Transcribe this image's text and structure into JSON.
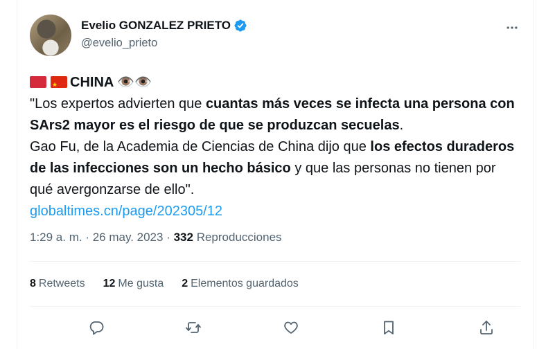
{
  "author": {
    "name": "Evelio GONZALEZ PRIETO",
    "handle": "@evelio_prieto",
    "verified_icon": "verified-badge-icon"
  },
  "tweet": {
    "line1": "CHINA ",
    "eyes": "👁️👁️",
    "p1_a": "\"Los expertos advierten que ",
    "p1_b": "cuantas más veces se infecta una persona con SArs2 mayor es el riesgo de que se produzcan secuelas",
    "p1_c": ".",
    "p2_a": "Gao Fu, de la Academia de Ciencias de China dijo que ",
    "p2_b": "los efectos duraderos de las infecciones son un hecho básico",
    "p2_c": " y que las personas no tienen por qué avergonzarse de ello\".",
    "link": "globaltimes.cn/page/202305/12"
  },
  "meta": {
    "time": "1:29 a. m.",
    "sep": " · ",
    "date": "26 may. 2023",
    "sep2": " · ",
    "views_count": "332",
    "views_label": " Reproducciones"
  },
  "stats": {
    "retweets_count": "8",
    "retweets_label": "Retweets",
    "likes_count": "12",
    "likes_label": "Me gusta",
    "bookmarks_count": "2",
    "bookmarks_label": "Elementos guardados"
  },
  "colors": {
    "link": "#1d9bf0",
    "secondary_text": "#536471",
    "verified": "#1d9bf0"
  },
  "actions": [
    "reply-icon",
    "retweet-icon",
    "like-icon",
    "bookmark-icon",
    "share-icon"
  ]
}
